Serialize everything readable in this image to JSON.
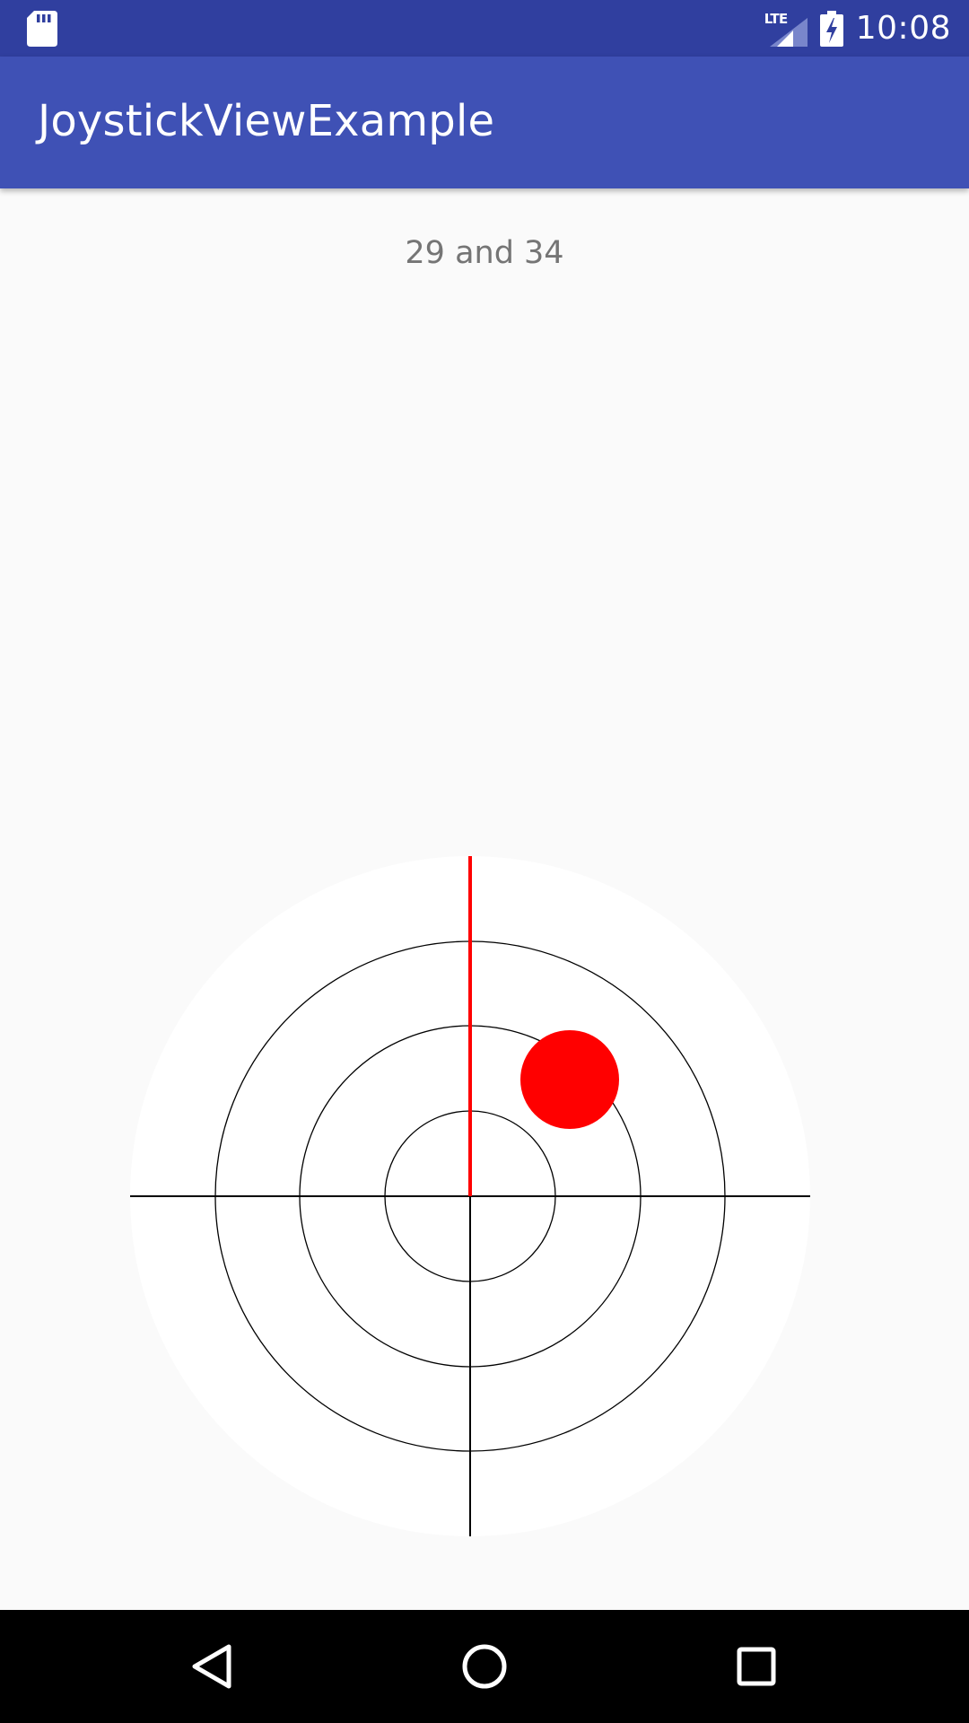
{
  "status_bar": {
    "time": "10:08",
    "network": "LTE",
    "icons": [
      "sd-card-icon",
      "signal-icon",
      "battery-charging-icon"
    ]
  },
  "app_bar": {
    "title": "JoystickViewExample"
  },
  "readout": {
    "text": "29 and 34"
  },
  "joystick": {
    "angle_deg": 29,
    "power_percent": 34,
    "colors": {
      "background": "#ffffff",
      "rings": "#000000",
      "axes": "#000000",
      "direction_line": "#ff0000",
      "knob": "#ff0000"
    }
  },
  "nav_bar": {
    "buttons": [
      "back-icon",
      "home-icon",
      "recents-icon"
    ]
  },
  "theme": {
    "primary": "#3f51b5",
    "primary_dark": "#303f9f",
    "window_background": "#fafafa"
  }
}
